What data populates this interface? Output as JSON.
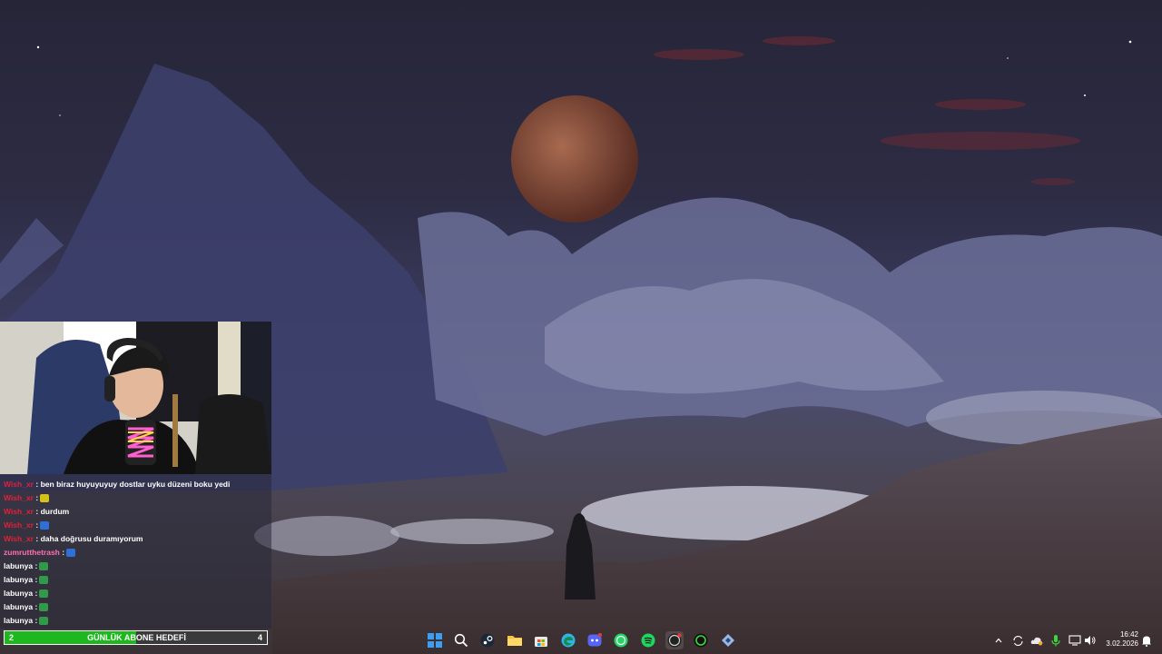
{
  "chat": {
    "messages": [
      {
        "user": "Wish_xr",
        "user_color": "#e0203a",
        "text": "ben biraz huyuyuyuy dostlar uyku düzeni boku yedi",
        "emote": ""
      },
      {
        "user": "Wish_xr",
        "user_color": "#e0203a",
        "text": "",
        "emote": "#d4c21a"
      },
      {
        "user": "Wish_xr",
        "user_color": "#e0203a",
        "text": "durdum",
        "emote": ""
      },
      {
        "user": "Wish_xr",
        "user_color": "#e0203a",
        "text": "",
        "emote": "#2f6fd8"
      },
      {
        "user": "Wish_xr",
        "user_color": "#e0203a",
        "text": "daha doğrusu duramıyorum",
        "emote": ""
      },
      {
        "user": "zumrutthetrash",
        "user_color": "#ff6fb1",
        "text": "",
        "emote": "#2f6fd8"
      },
      {
        "user": "labunya",
        "user_color": "#ffffff",
        "text": "",
        "emote": "#2e9a4a"
      },
      {
        "user": "labunya",
        "user_color": "#ffffff",
        "text": "",
        "emote": "#2e9a4a"
      },
      {
        "user": "labunya",
        "user_color": "#ffffff",
        "text": "",
        "emote": "#2e9a4a"
      },
      {
        "user": "labunya",
        "user_color": "#ffffff",
        "text": "",
        "emote": "#2e9a4a"
      },
      {
        "user": "labunya",
        "user_color": "#ffffff",
        "text": "",
        "emote": "#2e9a4a"
      }
    ],
    "separator": ":"
  },
  "goal": {
    "current": "2",
    "label": "GÜNLÜK ABONE HEDEFİ",
    "target": "4",
    "progress": 0.5,
    "fill_color": "#1db81d"
  },
  "taskbar": {
    "apps": [
      {
        "name": "start-icon",
        "color": "#3a9ef5"
      },
      {
        "name": "search-icon",
        "color": "#ffffff"
      },
      {
        "name": "steam-icon",
        "color": "#ffffff"
      },
      {
        "name": "file-explorer-icon",
        "color": "#f5c542"
      },
      {
        "name": "microsoft-store-icon",
        "color": "#e8e8e8"
      },
      {
        "name": "edge-icon",
        "color": "#2fb4e6"
      },
      {
        "name": "discord-icon",
        "color": "#5865f2"
      },
      {
        "name": "whatsapp-icon",
        "color": "#25d366"
      },
      {
        "name": "spotify-icon",
        "color": "#1ed760"
      },
      {
        "name": "obs-icon",
        "color": "#d0d0d0"
      },
      {
        "name": "razer-icon",
        "color": "#3ad83a"
      },
      {
        "name": "network-app-icon",
        "color": "#9ab8e6"
      }
    ],
    "tray": [
      "chevron-up-icon",
      "sync-icon",
      "cloud-icon",
      "microphone-icon",
      "display-icon",
      "volume-icon"
    ],
    "time": "16:42",
    "date": "3.02.2026",
    "notification_icon": "bell-icon"
  }
}
